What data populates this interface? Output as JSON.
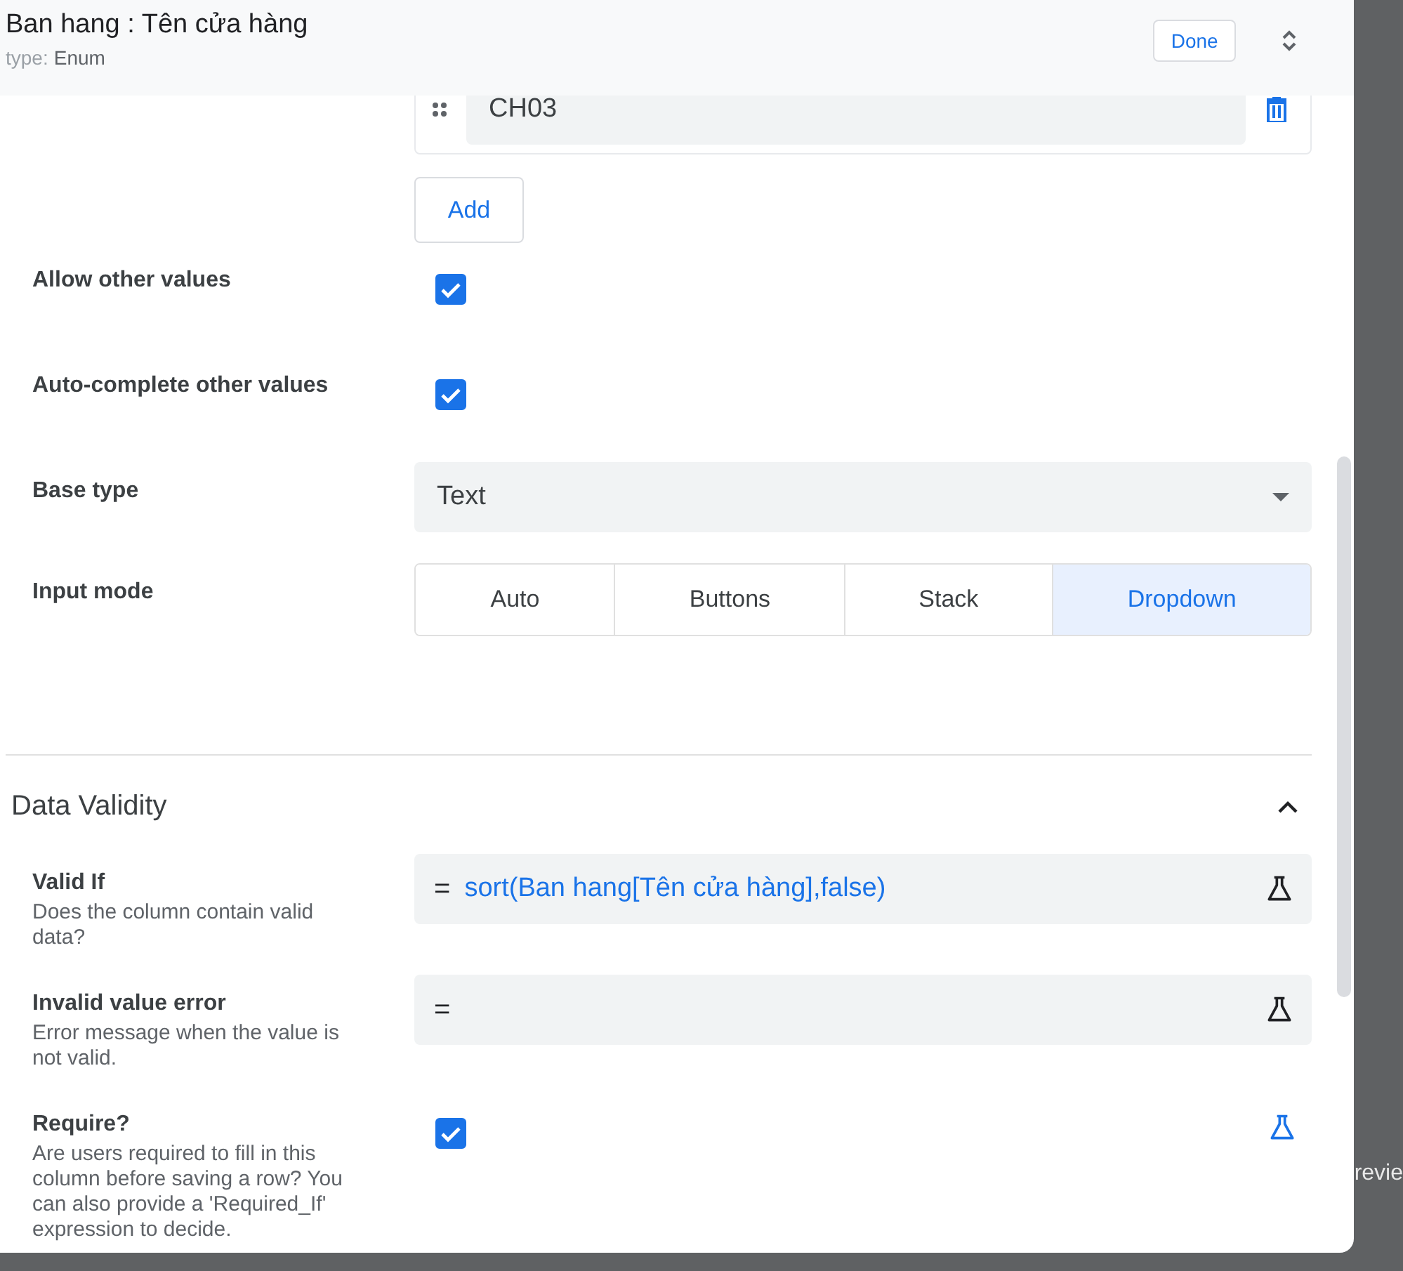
{
  "header": {
    "title": "Ban hang : Tên cửa hàng",
    "type_label": "type:",
    "type_value": "Enum",
    "done_button": "Done"
  },
  "options": [
    {
      "value": "CH03"
    }
  ],
  "add_button": "Add",
  "settings": [
    {
      "kind": "checkbox",
      "label": "Allow other values",
      "checked": true
    },
    {
      "kind": "checkbox",
      "label": "Auto-complete other values",
      "checked": true
    },
    {
      "kind": "select",
      "label": "Base type",
      "value": "Text"
    },
    {
      "kind": "segmented",
      "label": "Input mode",
      "segments": [
        {
          "label": "Auto",
          "selected": false
        },
        {
          "label": "Buttons",
          "selected": false
        },
        {
          "label": "Stack",
          "selected": false
        },
        {
          "label": "Dropdown",
          "selected": true
        }
      ]
    }
  ],
  "section": {
    "title": "Data Validity",
    "expanded": true
  },
  "validity": [
    {
      "kind": "formula",
      "label": "Valid If",
      "description": "Does the column contain valid data?",
      "prefix": "=",
      "value": "sort(Ban hang[Tên cửa hàng],false)"
    },
    {
      "kind": "formula",
      "label": "Invalid value error",
      "description": "Error message when the value is not valid.",
      "prefix": "="
    },
    {
      "kind": "checkbox",
      "label": "Require?",
      "description": "Are users required to fill in this column before saving a row? You can also provide a 'Required_If' expression to decide.",
      "checked": true
    }
  ],
  "background": {
    "fragment": "revie"
  }
}
